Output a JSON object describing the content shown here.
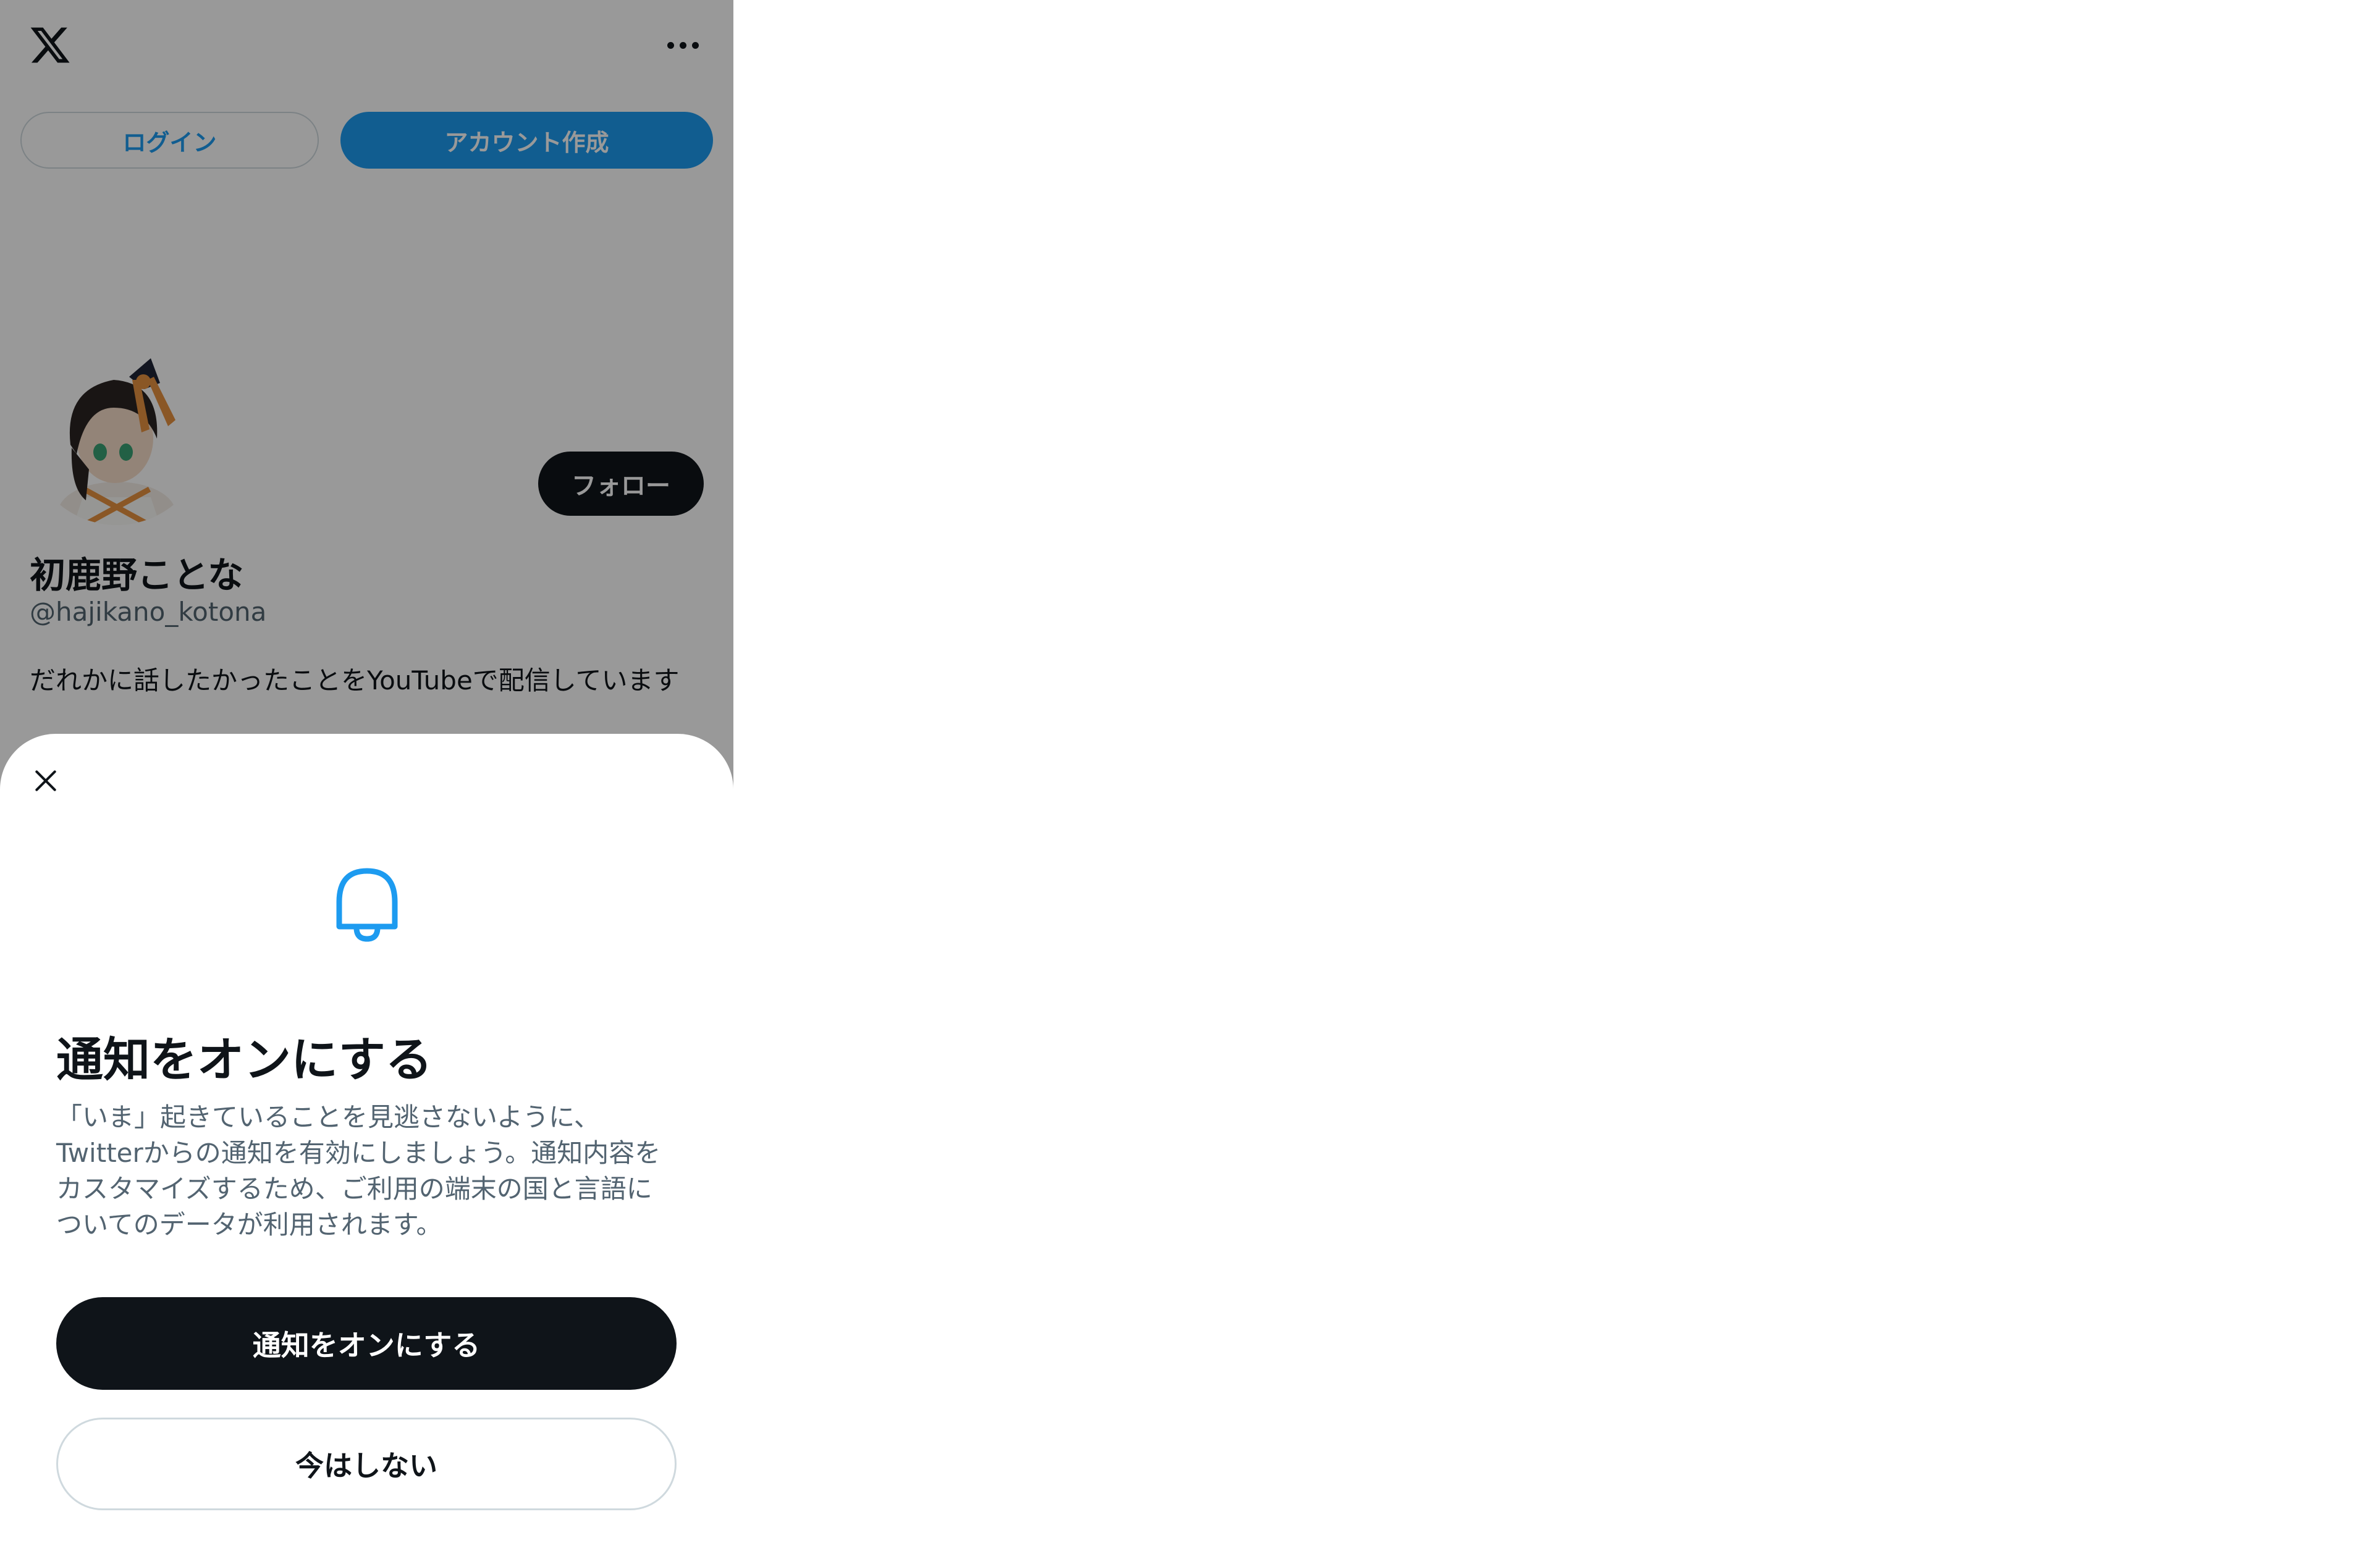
{
  "header": {
    "logo_icon": "x-logo-icon",
    "more_icon": "more-horizontal-icon",
    "login_label": "ログイン",
    "create_account_label": "アカウント作成"
  },
  "profile": {
    "display_name": "初鹿野ことな",
    "handle": "@hajikano_kotona",
    "bio": "だれかに話したかったことをYouTubeで配信しています",
    "follow_label": "フォロー"
  },
  "notification_sheet": {
    "close_icon": "close-icon",
    "bell_icon": "bell-icon",
    "title": "通知をオンにする",
    "description_lines": [
      "「いま」起きていることを見逃さないように、",
      "Twitterからの通知を有効にしましょう。通知内容を",
      "カスタマイズするため、ご利用の端末の国と言語に",
      "ついてのデータが利用されます。"
    ],
    "enable_label": "通知をオンにする",
    "not_now_label": "今はしない"
  },
  "colors": {
    "accent": "#1d9bf0",
    "dark": "#0f1419",
    "secondary_text": "#536471",
    "border": "#cfd9de"
  }
}
